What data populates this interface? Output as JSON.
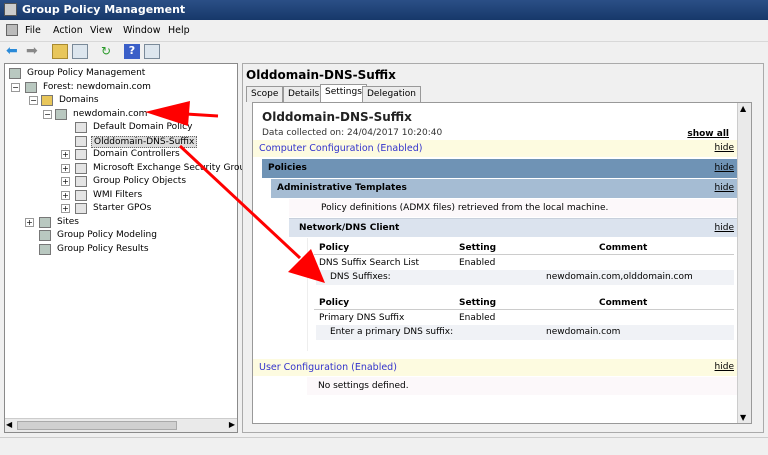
{
  "window": {
    "title": "Group Policy Management"
  },
  "menu": [
    "File",
    "Action",
    "View",
    "Window",
    "Help"
  ],
  "window_buttons": [
    "_",
    "❐",
    "✕"
  ],
  "tree": [
    {
      "label": "Group Policy Management",
      "level": 0,
      "expander": ""
    },
    {
      "label": "Forest: newdomain.com",
      "level": 1,
      "expander": "−"
    },
    {
      "label": "Domains",
      "level": 2,
      "expander": "−"
    },
    {
      "label": "newdomain.com",
      "level": 3,
      "expander": "−"
    },
    {
      "label": "Default Domain Policy",
      "level": 4,
      "expander": ""
    },
    {
      "label": "Olddomain-DNS-Suffix",
      "level": 4,
      "expander": "",
      "selected": true
    },
    {
      "label": "Domain Controllers",
      "level": 4,
      "expander": "+"
    },
    {
      "label": "Microsoft Exchange Security Groups",
      "level": 4,
      "expander": "+"
    },
    {
      "label": "Group Policy Objects",
      "level": 4,
      "expander": "+"
    },
    {
      "label": "WMI Filters",
      "level": 4,
      "expander": "+"
    },
    {
      "label": "Starter GPOs",
      "level": 4,
      "expander": "+"
    },
    {
      "label": "Sites",
      "level": 1,
      "expander": "+"
    },
    {
      "label": "Group Policy Modeling",
      "level": 1,
      "expander": ""
    },
    {
      "label": "Group Policy Results",
      "level": 1,
      "expander": ""
    }
  ],
  "right": {
    "header": "Olddomain-DNS-Suffix",
    "tabs": [
      "Scope",
      "Details",
      "Settings",
      "Delegation"
    ],
    "active_tab": "Settings",
    "report_title": "Olddomain-DNS-Suffix",
    "collected": "Data collected on: 24/04/2017 10:20:40",
    "show_all": "show all",
    "hide": "hide",
    "computer_config": "Computer Configuration (Enabled)",
    "policies": "Policies",
    "admin_templates": "Administrative Templates",
    "policy_defs": "Policy definitions (ADMX files) retrieved from the local machine.",
    "network_dns": "Network/DNS Client",
    "col_policy": "Policy",
    "col_setting": "Setting",
    "col_comment": "Comment",
    "p1": {
      "name": "DNS Suffix Search List",
      "setting": "Enabled",
      "sub_label": "DNS Suffixes:",
      "sub_value": "newdomain.com,olddomain.com"
    },
    "p2": {
      "name": "Primary DNS Suffix",
      "setting": "Enabled",
      "sub_label": "Enter a primary DNS suffix:",
      "sub_value": "newdomain.com"
    },
    "user_config": "User Configuration (Enabled)",
    "no_settings": "No settings defined."
  },
  "colors": {
    "title": "#1f4274",
    "policies_bar": "#6f93b5",
    "admin_bar": "#a5bcd3",
    "network_bar": "#dbe3ee",
    "config_bar": "#fdfbe0",
    "link": "#3333cc",
    "annotation": "#ff0000"
  }
}
